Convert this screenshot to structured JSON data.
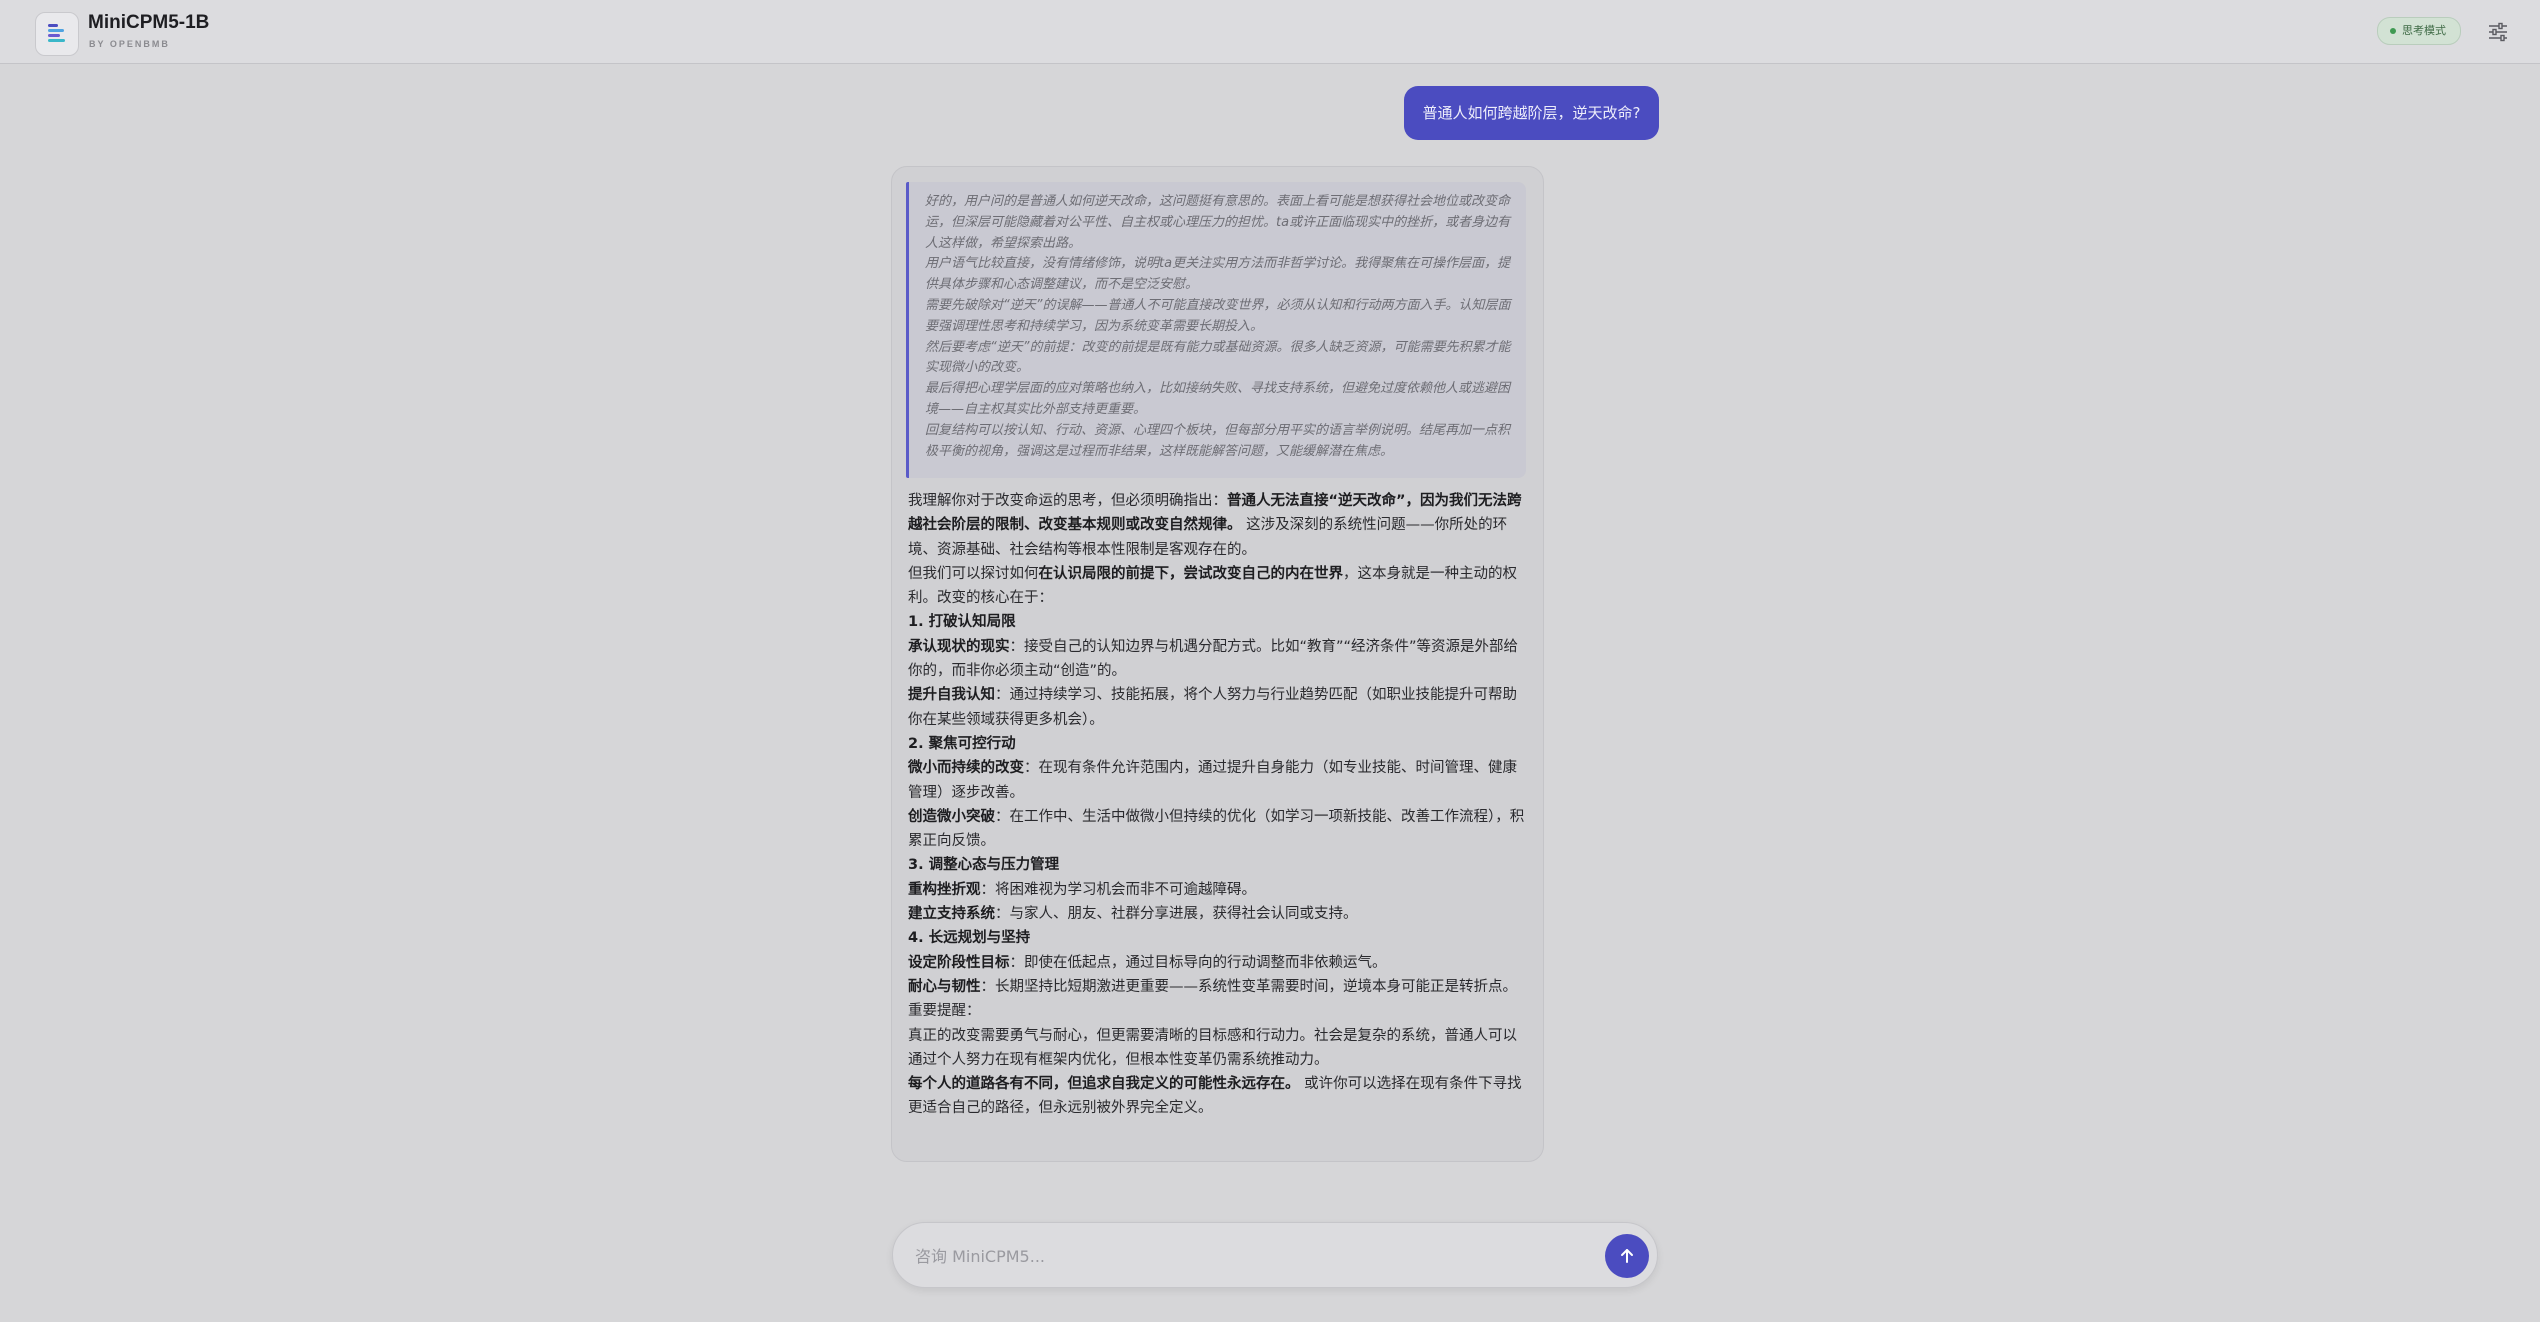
{
  "header": {
    "title": "MiniCPM5-1B",
    "subtitle": "BY OPENBMB",
    "mode_badge": "思考模式",
    "logo_icon": "bars-logo-icon",
    "settings_icon": "sliders-icon"
  },
  "colors": {
    "accent": "#4b4cc0",
    "badge_green": "#3f9a52"
  },
  "chat": {
    "user_message": "普通人如何跨越阶层，逆天改命?",
    "thinking": [
      "好的，用户问的是普通人如何逆天改命，这问题挺有意思的。表面上看可能是想获得社会地位或改变命运，但深层可能隐藏着对公平性、自主权或心理压力的担忧。ta或许正面临现实中的挫折，或者身边有人这样做，希望探索出路。",
      "用户语气比较直接，没有情绪修饰，说明ta更关注实用方法而非哲学讨论。我得聚焦在可操作层面，提供具体步骤和心态调整建议，而不是空泛安慰。",
      "需要先破除对“逆天”的误解——普通人不可能直接改变世界，必须从认知和行动两方面入手。认知层面要强调理性思考和持续学习，因为系统变革需要长期投入。",
      "然后要考虑“逆天”的前提：改变的前提是既有能力或基础资源。很多人缺乏资源，可能需要先积累才能实现微小的改变。",
      "最后得把心理学层面的应对策略也纳入，比如接纳失败、寻找支持系统，但避免过度依赖他人或逃避困境——自主权其实比外部支持更重要。",
      "回复结构可以按认知、行动、资源、心理四个板块，但每部分用平实的语言举例说明。结尾再加一点积极平衡的视角，强调这是过程而非结果，这样既能解答问题，又能缓解潜在焦虑。"
    ],
    "answer": {
      "intro_prefix": "我理解你对于改变命运的思考，但必须明确指出：",
      "intro_bold": "普通人无法直接“逆天改命”，因为我们无法跨越社会阶层的限制、改变基本规则或改变自然规律。",
      "intro_suffix": " 这涉及深刻的系统性问题——你所处的环境、资源基础、社会结构等根本性限制是客观存在的。",
      "p2_prefix": "但我们可以探讨如何",
      "p2_bold": "在认识局限的前提下，尝试改变自己的内在世界",
      "p2_suffix": "，这本身就是一种主动的权利。改变的核心在于：",
      "s1_title": "1. 打破认知局限",
      "s1_a_bold": "承认现状的现实",
      "s1_a_text": "：接受自己的认知边界与机遇分配方式。比如“教育”“经济条件”等资源是外部给你的，而非你必须主动“创造”的。",
      "s1_b_bold": "提升自我认知",
      "s1_b_text": "：通过持续学习、技能拓展，将个人努力与行业趋势匹配（如职业技能提升可帮助你在某些领域获得更多机会）。",
      "s2_title": "2. 聚焦可控行动",
      "s2_a_bold": "微小而持续的改变",
      "s2_a_text": "：在现有条件允许范围内，通过提升自身能力（如专业技能、时间管理、健康管理）逐步改善。",
      "s2_b_bold": "创造微小突破",
      "s2_b_text": "：在工作中、生活中做微小但持续的优化（如学习一项新技能、改善工作流程），积累正向反馈。",
      "s3_title": "3. 调整心态与压力管理",
      "s3_a_bold": "重构挫折观",
      "s3_a_text": "：将困难视为学习机会而非不可逾越障碍。",
      "s3_b_bold": "建立支持系统",
      "s3_b_text": "：与家人、朋友、社群分享进展，获得社会认同或支持。",
      "s4_title": "4. 长远规划与坚持",
      "s4_a_bold": "设定阶段性目标",
      "s4_a_text": "：即使在低起点，通过目标导向的行动调整而非依赖运气。",
      "s4_b_bold": "耐心与韧性",
      "s4_b_text": "：长期坚持比短期激进更重要——系统性变革需要时间，逆境本身可能正是转折点。",
      "reminder_label": "重要提醒：",
      "reminder_text": "真正的改变需要勇气与耐心，但更需要清晰的目标感和行动力。社会是复杂的系统，普通人可以通过个人努力在现有框架内优化，但根本性变革仍需系统推动力。",
      "closing_bold": "每个人的道路各有不同，但追求自我定义的可能性永远存在。",
      "closing_text": " 或许你可以选择在现有条件下寻找更适合自己的路径，但永远别被外界完全定义。"
    }
  },
  "composer": {
    "placeholder": "咨询 MiniCPM5...",
    "send_icon": "arrow-up-icon"
  }
}
